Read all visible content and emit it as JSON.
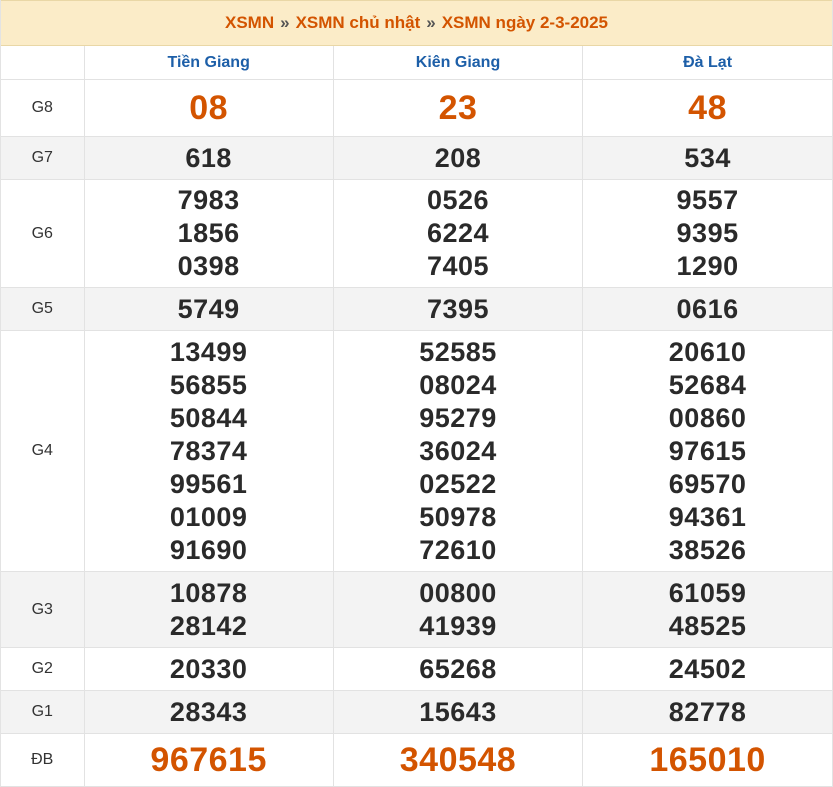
{
  "header": {
    "crumb1": "XSMN",
    "crumb2": "XSMN chủ nhật",
    "crumb3": "XSMN ngày 2-3-2025",
    "sep": "»"
  },
  "provinces": [
    "Tiền Giang",
    "Kiên Giang",
    "Đà Lạt"
  ],
  "rows": [
    {
      "label": "G8",
      "values": [
        [
          "08"
        ],
        [
          "23"
        ],
        [
          "48"
        ]
      ]
    },
    {
      "label": "G7",
      "values": [
        [
          "618"
        ],
        [
          "208"
        ],
        [
          "534"
        ]
      ]
    },
    {
      "label": "G6",
      "values": [
        [
          "7983",
          "1856",
          "0398"
        ],
        [
          "0526",
          "6224",
          "7405"
        ],
        [
          "9557",
          "9395",
          "1290"
        ]
      ]
    },
    {
      "label": "G5",
      "values": [
        [
          "5749"
        ],
        [
          "7395"
        ],
        [
          "0616"
        ]
      ]
    },
    {
      "label": "G4",
      "values": [
        [
          "13499",
          "56855",
          "50844",
          "78374",
          "99561",
          "01009",
          "91690"
        ],
        [
          "52585",
          "08024",
          "95279",
          "36024",
          "02522",
          "50978",
          "72610"
        ],
        [
          "20610",
          "52684",
          "00860",
          "97615",
          "69570",
          "94361",
          "38526"
        ]
      ]
    },
    {
      "label": "G3",
      "values": [
        [
          "10878",
          "28142"
        ],
        [
          "00800",
          "41939"
        ],
        [
          "61059",
          "48525"
        ]
      ]
    },
    {
      "label": "G2",
      "values": [
        [
          "20330"
        ],
        [
          "65268"
        ],
        [
          "24502"
        ]
      ]
    },
    {
      "label": "G1",
      "values": [
        [
          "28343"
        ],
        [
          "15643"
        ],
        [
          "82778"
        ]
      ]
    },
    {
      "label": "ĐB",
      "values": [
        [
          "967615"
        ],
        [
          "340548"
        ],
        [
          "165010"
        ]
      ]
    }
  ]
}
